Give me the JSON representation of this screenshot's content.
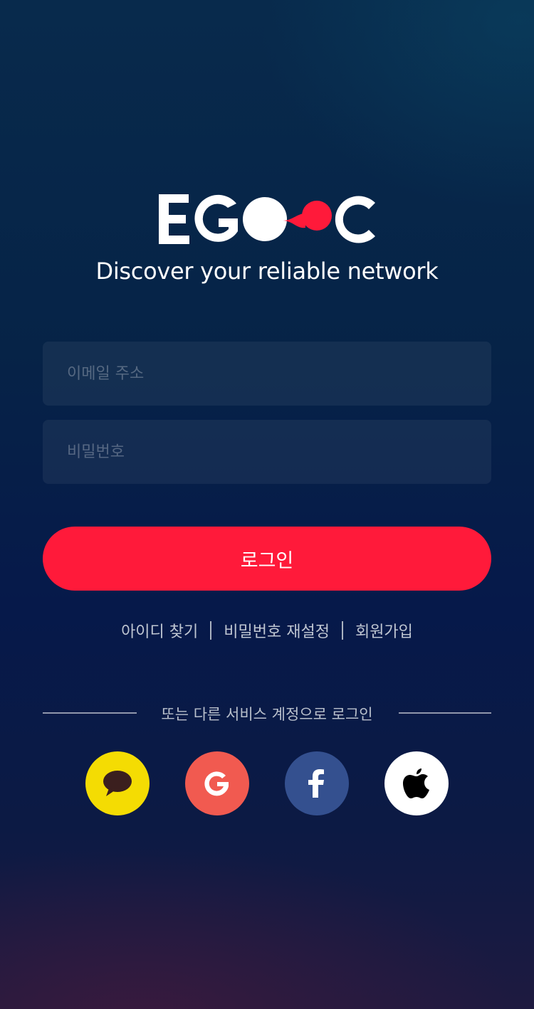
{
  "brand": {
    "logo_text": "EGOOC",
    "tagline": "Discover your reliable network",
    "accent_color": "#ff1a3a"
  },
  "login_form": {
    "email_placeholder": "이메일 주소",
    "password_placeholder": "비밀번호",
    "email_value": "",
    "password_value": "",
    "login_button_label": "로그인"
  },
  "links": {
    "find_id": "아이디 찾기",
    "reset_password": "비밀번호 재설정",
    "sign_up": "회원가입"
  },
  "social_login": {
    "divider_text": "또는 다른 서비스 계정으로 로그인",
    "providers": [
      {
        "name": "kakao",
        "icon": "chat-bubble-icon",
        "color": "#f4dc03"
      },
      {
        "name": "google",
        "icon": "google-g-icon",
        "color": "#f15a50"
      },
      {
        "name": "facebook",
        "icon": "facebook-f-icon",
        "color": "#34508f"
      },
      {
        "name": "apple",
        "icon": "apple-icon",
        "color": "#ffffff"
      }
    ]
  }
}
